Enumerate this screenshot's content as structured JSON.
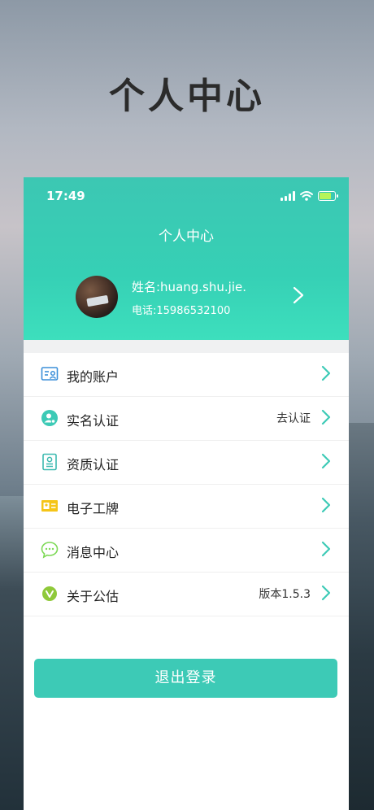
{
  "poster": {
    "title": "个人中心"
  },
  "status_bar": {
    "time": "17:49"
  },
  "header": {
    "title": "个人中心",
    "name": "姓名:huang.shu.jie.",
    "phone": "电话:15986532100"
  },
  "menu": {
    "items": [
      {
        "label": "我的账户",
        "value": "",
        "icon": "account-card-icon"
      },
      {
        "label": "实名认证",
        "value": "去认证",
        "icon": "person-verify-icon"
      },
      {
        "label": "资质认证",
        "value": "",
        "icon": "certificate-icon"
      },
      {
        "label": "电子工牌",
        "value": "",
        "icon": "badge-card-icon"
      },
      {
        "label": "消息中心",
        "value": "",
        "icon": "chat-bubble-icon"
      },
      {
        "label": "关于公估",
        "value": "版本1.5.3",
        "icon": "v-circle-icon"
      }
    ]
  },
  "logout": {
    "label": "退出登录"
  },
  "colors": {
    "accent": "#3dcab6",
    "header": "#36d0b5"
  }
}
